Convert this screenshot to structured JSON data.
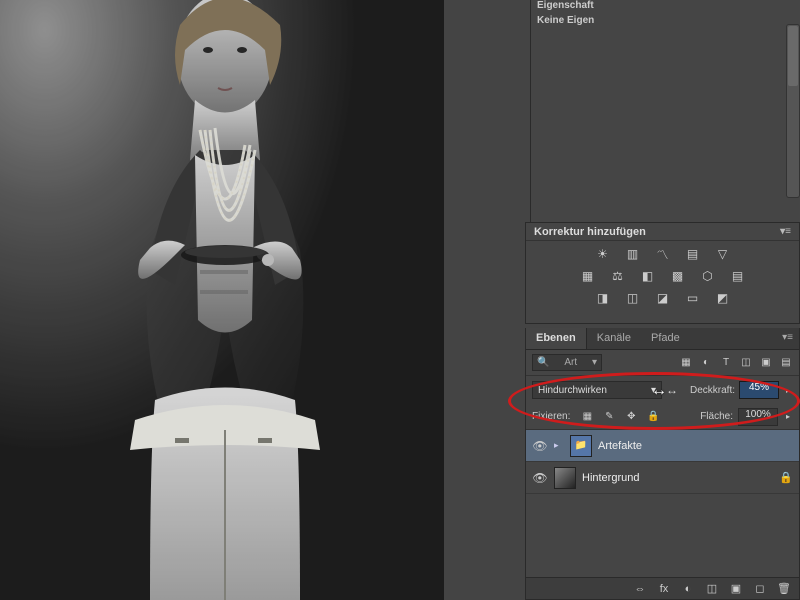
{
  "properties": {
    "header_fragment": "Eigenschaft",
    "none": "Keine Eigen"
  },
  "adjustments": {
    "title": "Korrektur hinzufügen",
    "menu_glyph": "▾≡",
    "row1": [
      "brightness",
      "levels",
      "curves",
      "exposure",
      "vibrance"
    ],
    "row2": [
      "hsl",
      "balance",
      "bw",
      "photo",
      "lut",
      "mosaic"
    ],
    "row3": [
      "invert",
      "poster",
      "thresh",
      "grad",
      "tone"
    ]
  },
  "layers": {
    "tabs": [
      "Ebenen",
      "Kanäle",
      "Pfade"
    ],
    "active_tab": 0,
    "filter": {
      "kind_label": "Art",
      "search_glyph": "🔍",
      "dropdown_glyph": "▾"
    },
    "filter_icons": [
      "▦",
      "◐",
      "T",
      "◫",
      "▣",
      "▤"
    ],
    "blend_mode": "Hindurchwirken",
    "dropdown_glyph": "▾",
    "scrub_glyph": "↔",
    "opacity_label": "Deckkraft:",
    "opacity_value": "45%",
    "opacity_arrow": "▸",
    "lock_label": "Fixieren:",
    "lock_icons": [
      "▦",
      "✎",
      "✥",
      "🔒"
    ],
    "fill_label": "Fläche:",
    "fill_value": "100%",
    "fill_arrow": "▸",
    "items": [
      {
        "name": "Artefakte",
        "type": "group",
        "visible": true,
        "disclosure": "▸",
        "folder_glyph": "📁"
      },
      {
        "name": "Hintergrund",
        "type": "image",
        "visible": true,
        "locked": true,
        "lock_glyph": "🔒"
      }
    ],
    "eye_glyph": "👁",
    "footer_icons": [
      "⇔",
      "fx",
      "◐",
      "◫",
      "▣",
      "◻",
      "🗑"
    ]
  }
}
